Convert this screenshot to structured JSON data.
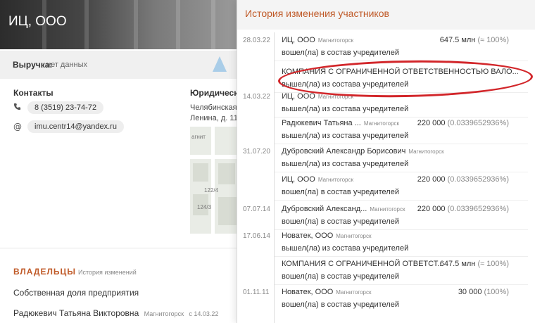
{
  "company": {
    "title": "ИЦ, ООО"
  },
  "revenue": {
    "label": "Выручка:",
    "value": "нет данных"
  },
  "contacts": {
    "title": "Контакты",
    "phone": "8 (3519) 23-74-72",
    "email": "imu.centr14@yandex.ru"
  },
  "legal": {
    "title": "Юридический",
    "address_line1": "Челябинская",
    "address_line2": "Ленина, д. 11"
  },
  "map": {
    "labels": [
      "агнит",
      "122/4",
      "124/3"
    ]
  },
  "owners": {
    "title": "ВЛАДЕЛЬЦЫ",
    "history_link": "История изменений",
    "share_label": "Собственная доля предприятия",
    "owner_name": "Радюкевич Татьяна Викторовна",
    "owner_city": "Магнитогорск",
    "owner_since": "с 14.03.22"
  },
  "panel": {
    "title": "История изменения участников",
    "entries": [
      {
        "date": "28.03.22",
        "name": "ИЦ, ООО",
        "city": "Магнитогорск",
        "amount": "647.5 млн",
        "pct": "(≈ 100%)",
        "action": "вошел(ла) в состав учредителей",
        "count": ""
      },
      {
        "date": "",
        "name": "КОМПАНИЯ С ОГРАНИЧЕННОЙ ОТВЕТСТВЕННОСТЬЮ ВАЛО...",
        "city": "",
        "amount": "",
        "pct": "",
        "action": "вышел(ла) из состава учредителей",
        "count": ""
      },
      {
        "date": "14.03.22",
        "name": "ИЦ, ООО",
        "city": "Магнитогорск",
        "amount": "",
        "pct": "",
        "action": "вышел(ла) из состава учредителей",
        "count": ""
      },
      {
        "date": "",
        "name": "Радюкевич Татьяна ...",
        "city": "Магнитогорск",
        "amount": "220 000",
        "pct": "(0.0339652936%)",
        "action": "вышел(ла) из состава учредителей",
        "count": ""
      },
      {
        "date": "31.07.20",
        "name": "Дубровский Александр Борисович",
        "city": "Магнитогорск",
        "amount": "",
        "pct": "",
        "action": "вышел(ла) из состава учредителей",
        "count": ""
      },
      {
        "date": "",
        "name": "ИЦ, ООО",
        "city": "Магнитогорск",
        "amount": "220 000",
        "pct": "(0.0339652936%)",
        "action": "вошел(ла) в состав учредителей",
        "count": ""
      },
      {
        "date": "07.07.14",
        "name": "Дубровский Александ...",
        "city": "Магнитогорск",
        "amount": "220 000",
        "pct": "(0.0339652936%)",
        "action": "вошел(ла) в состав учредителей",
        "count": ""
      },
      {
        "date": "17.06.14",
        "name": "Новатек, ООО",
        "city": "Магнитогорск",
        "amount": "",
        "pct": "",
        "action": "вышел(ла) из состава учредителей",
        "count": ""
      },
      {
        "date": "",
        "name": "КОМПАНИЯ С ОГРАНИЧЕННОЙ ОТВЕТСТ...",
        "city": "",
        "amount": "647.5 млн",
        "pct": "(≈ 100%)",
        "action": "вошел(ла) в состав учредителей",
        "count": ""
      },
      {
        "date": "01.11.11",
        "name": "Новатек, ООО",
        "city": "Магнитогорск",
        "amount": "30 000",
        "pct": "(100%)",
        "action": "вошел(ла) в состав учредителей",
        "count": ""
      }
    ]
  },
  "colors": {
    "accent": "#c05a28",
    "highlight": "#d2262a"
  }
}
